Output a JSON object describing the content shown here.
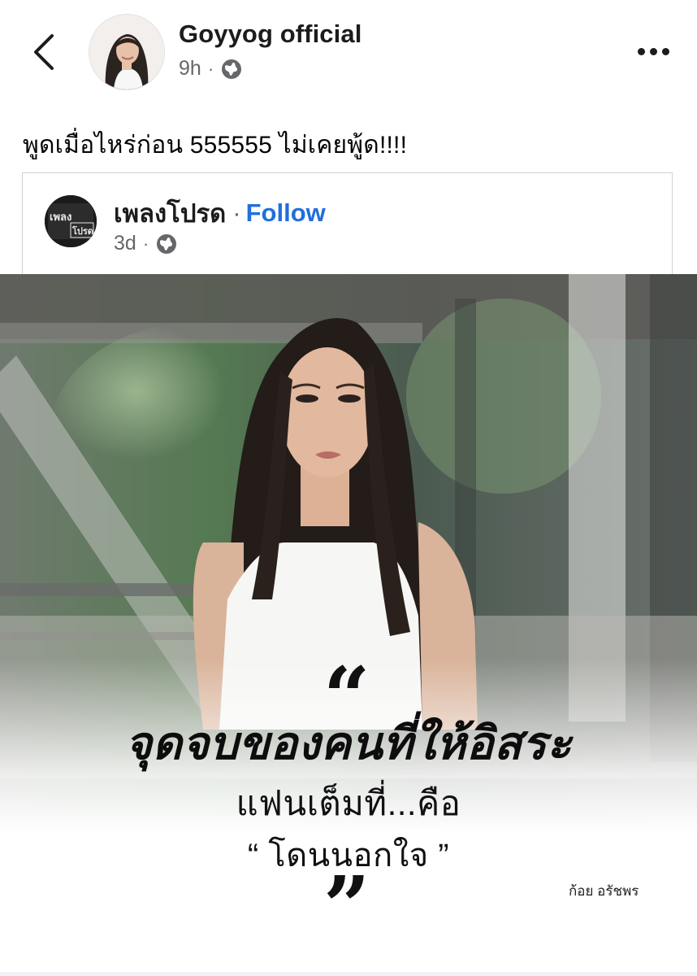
{
  "header": {
    "page_name": "Goyyog official",
    "time": "9h",
    "separator": "·",
    "audience_icon": "globe-icon",
    "back_icon": "chevron-left-icon",
    "more_icon": "more-horizontal-icon"
  },
  "post": {
    "caption": "พูดเมื่อไหร่ก่อน 555555 ไม่เคยพู้ด!!!!"
  },
  "shared": {
    "page_name": "เพลงโปรด",
    "separator": "·",
    "follow_label": "Follow",
    "time": "3d",
    "avatar_text_top": "เพลง",
    "avatar_text_bottom": "โปรด"
  },
  "image": {
    "open_quote": "“",
    "line1": "จุดจบของคนที่ให้อิสระ",
    "line2": "แฟนเต็มที่...คือ",
    "line3": "“ โดนนอกใจ ”",
    "close_quote": "”",
    "author": "ก้อย อรัชพร"
  },
  "colors": {
    "follow": "#216fdb",
    "meta": "#65676b"
  }
}
